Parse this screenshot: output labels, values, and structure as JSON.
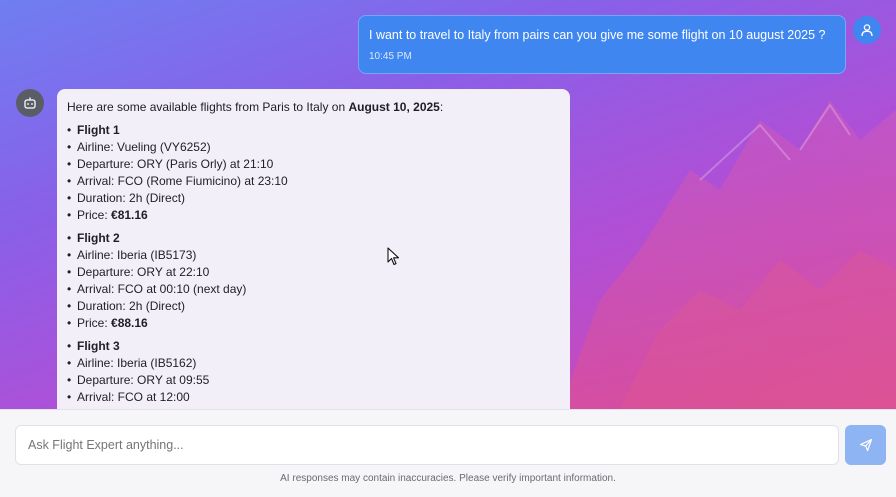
{
  "user_message": {
    "text": "I want to travel to Italy from pairs can you give me some flight on 10 august 2025 ?",
    "time": "10:45 PM"
  },
  "bot_message": {
    "intro": "Here are some available flights from Paris to Italy on ",
    "intro_date": "August 10, 2025",
    "intro_colon": ":",
    "flights": [
      {
        "title": "Flight 1",
        "airline": "Airline: Vueling (VY6252)",
        "departure": "Departure: ORY (Paris Orly) at 21:10",
        "arrival": "Arrival: FCO (Rome Fiumicino) at 23:10",
        "duration": "Duration: 2h (Direct)",
        "price_label": "Price: ",
        "price": "€81.16"
      },
      {
        "title": "Flight 2",
        "airline": "Airline: Iberia (IB5173)",
        "departure": "Departure: ORY at 22:10",
        "arrival": "Arrival: FCO at 00:10 (next day)",
        "duration": "Duration: 2h (Direct)",
        "price_label": "Price: ",
        "price": "€88.16"
      },
      {
        "title": "Flight 3",
        "airline": "Airline: Iberia (IB5162)",
        "departure": "Departure: ORY at 09:55",
        "arrival": "Arrival: FCO at 12:00"
      }
    ]
  },
  "composer": {
    "placeholder": "Ask Flight Expert anything...",
    "disclaimer": "AI responses may contain inaccuracies. Please verify important information."
  },
  "icons": {
    "user_avatar": "user-icon",
    "bot_avatar": "bot-icon",
    "send": "send-icon",
    "cursor": "mouse-cursor-icon"
  },
  "colors": {
    "user_bubble": "#3f86f0",
    "send_button": "#8fb4f3",
    "bot_bubble": "#f3eff9",
    "bot_avatar": "#5b5d66"
  }
}
